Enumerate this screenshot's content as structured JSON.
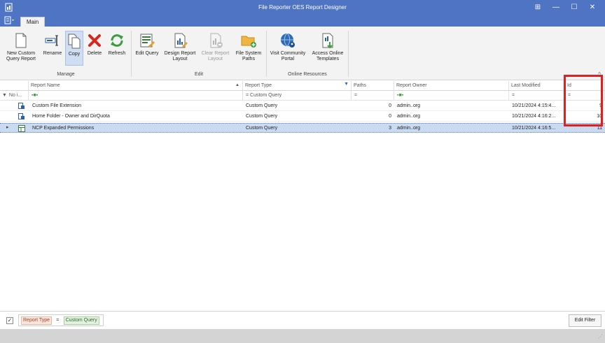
{
  "window": {
    "title": "File Reporter OES Report Designer",
    "controls": [
      "⊞",
      "—",
      "☐",
      "✕"
    ]
  },
  "tabs": {
    "main": "Main"
  },
  "ribbon": {
    "manage": {
      "label": "Manage",
      "new_label_1": "New Custom",
      "new_label_2": "Query Report",
      "rename": "Rename",
      "copy": "Copy",
      "delete": "Delete",
      "refresh": "Refresh"
    },
    "edit": {
      "label": "Edit",
      "edit_query": "Edit Query",
      "design_1": "Design Report",
      "design_2": "Layout",
      "clear_1": "Clear Report",
      "clear_2": "Layout",
      "fs_1": "File System",
      "fs_2": "Paths"
    },
    "online": {
      "label": "Online Resources",
      "community_1": "Visit Community",
      "community_2": "Portal",
      "templates_1": "Access Online",
      "templates_2": "Templates"
    },
    "collapse": "^"
  },
  "grid": {
    "columns": {
      "name": "Report Name",
      "type": "Report Type",
      "paths": "Paths",
      "owner": "Report Owner",
      "modified": "Last Modified",
      "id": "Id"
    },
    "filter_row": {
      "name": "No i...",
      "type": "= Custom Query",
      "paths": "=",
      "modified": "=",
      "id": "="
    },
    "rows": [
      {
        "name": "Custom File Extension",
        "type": "Custom Query",
        "paths": "0",
        "owner": "admin..org",
        "modified": "10/21/2024 4:15:4...",
        "id": "9"
      },
      {
        "name": "Home Folder - Owner and DirQuota",
        "type": "Custom Query",
        "paths": "0",
        "owner": "admin..org",
        "modified": "10/21/2024 4:16:2...",
        "id": "10"
      },
      {
        "name": "NCP Expanded Permissions",
        "type": "Custom Query",
        "paths": "3",
        "owner": "admin..org",
        "modified": "10/21/2024 4:16:5...",
        "id": "11"
      }
    ]
  },
  "filter_panel": {
    "check": "✓",
    "field": "Report Type",
    "operator": "=",
    "value": "Custom Query",
    "edit_filter": "Edit Filter"
  },
  "colors": {
    "titlebar": "#4f74c4",
    "selection": "#c9daf1",
    "highlight": "#e02020"
  }
}
